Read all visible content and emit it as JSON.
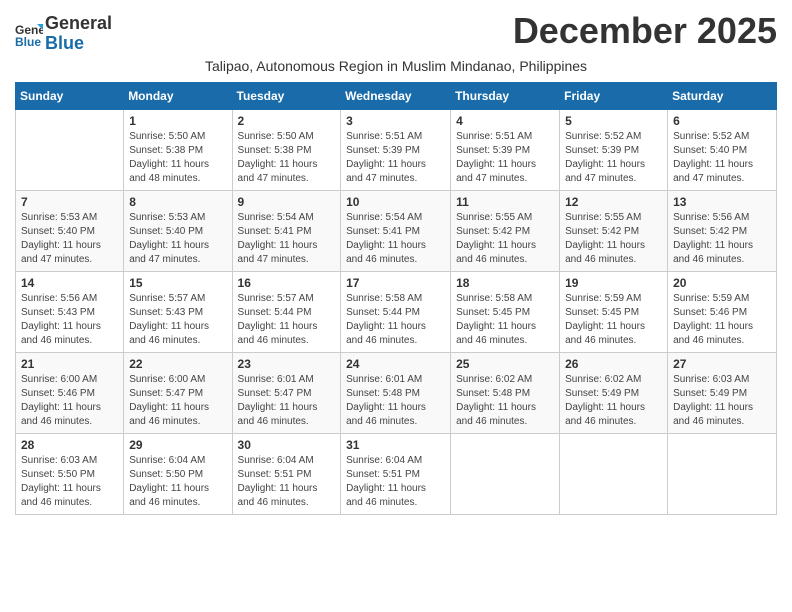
{
  "logo": {
    "line1": "General",
    "line2": "Blue"
  },
  "title": "December 2025",
  "subtitle": "Talipao, Autonomous Region in Muslim Mindanao, Philippines",
  "days_of_week": [
    "Sunday",
    "Monday",
    "Tuesday",
    "Wednesday",
    "Thursday",
    "Friday",
    "Saturday"
  ],
  "weeks": [
    [
      {
        "day": "",
        "info": ""
      },
      {
        "day": "1",
        "info": "Sunrise: 5:50 AM\nSunset: 5:38 PM\nDaylight: 11 hours\nand 48 minutes."
      },
      {
        "day": "2",
        "info": "Sunrise: 5:50 AM\nSunset: 5:38 PM\nDaylight: 11 hours\nand 47 minutes."
      },
      {
        "day": "3",
        "info": "Sunrise: 5:51 AM\nSunset: 5:39 PM\nDaylight: 11 hours\nand 47 minutes."
      },
      {
        "day": "4",
        "info": "Sunrise: 5:51 AM\nSunset: 5:39 PM\nDaylight: 11 hours\nand 47 minutes."
      },
      {
        "day": "5",
        "info": "Sunrise: 5:52 AM\nSunset: 5:39 PM\nDaylight: 11 hours\nand 47 minutes."
      },
      {
        "day": "6",
        "info": "Sunrise: 5:52 AM\nSunset: 5:40 PM\nDaylight: 11 hours\nand 47 minutes."
      }
    ],
    [
      {
        "day": "7",
        "info": "Sunrise: 5:53 AM\nSunset: 5:40 PM\nDaylight: 11 hours\nand 47 minutes."
      },
      {
        "day": "8",
        "info": "Sunrise: 5:53 AM\nSunset: 5:40 PM\nDaylight: 11 hours\nand 47 minutes."
      },
      {
        "day": "9",
        "info": "Sunrise: 5:54 AM\nSunset: 5:41 PM\nDaylight: 11 hours\nand 47 minutes."
      },
      {
        "day": "10",
        "info": "Sunrise: 5:54 AM\nSunset: 5:41 PM\nDaylight: 11 hours\nand 46 minutes."
      },
      {
        "day": "11",
        "info": "Sunrise: 5:55 AM\nSunset: 5:42 PM\nDaylight: 11 hours\nand 46 minutes."
      },
      {
        "day": "12",
        "info": "Sunrise: 5:55 AM\nSunset: 5:42 PM\nDaylight: 11 hours\nand 46 minutes."
      },
      {
        "day": "13",
        "info": "Sunrise: 5:56 AM\nSunset: 5:42 PM\nDaylight: 11 hours\nand 46 minutes."
      }
    ],
    [
      {
        "day": "14",
        "info": "Sunrise: 5:56 AM\nSunset: 5:43 PM\nDaylight: 11 hours\nand 46 minutes."
      },
      {
        "day": "15",
        "info": "Sunrise: 5:57 AM\nSunset: 5:43 PM\nDaylight: 11 hours\nand 46 minutes."
      },
      {
        "day": "16",
        "info": "Sunrise: 5:57 AM\nSunset: 5:44 PM\nDaylight: 11 hours\nand 46 minutes."
      },
      {
        "day": "17",
        "info": "Sunrise: 5:58 AM\nSunset: 5:44 PM\nDaylight: 11 hours\nand 46 minutes."
      },
      {
        "day": "18",
        "info": "Sunrise: 5:58 AM\nSunset: 5:45 PM\nDaylight: 11 hours\nand 46 minutes."
      },
      {
        "day": "19",
        "info": "Sunrise: 5:59 AM\nSunset: 5:45 PM\nDaylight: 11 hours\nand 46 minutes."
      },
      {
        "day": "20",
        "info": "Sunrise: 5:59 AM\nSunset: 5:46 PM\nDaylight: 11 hours\nand 46 minutes."
      }
    ],
    [
      {
        "day": "21",
        "info": "Sunrise: 6:00 AM\nSunset: 5:46 PM\nDaylight: 11 hours\nand 46 minutes."
      },
      {
        "day": "22",
        "info": "Sunrise: 6:00 AM\nSunset: 5:47 PM\nDaylight: 11 hours\nand 46 minutes."
      },
      {
        "day": "23",
        "info": "Sunrise: 6:01 AM\nSunset: 5:47 PM\nDaylight: 11 hours\nand 46 minutes."
      },
      {
        "day": "24",
        "info": "Sunrise: 6:01 AM\nSunset: 5:48 PM\nDaylight: 11 hours\nand 46 minutes."
      },
      {
        "day": "25",
        "info": "Sunrise: 6:02 AM\nSunset: 5:48 PM\nDaylight: 11 hours\nand 46 minutes."
      },
      {
        "day": "26",
        "info": "Sunrise: 6:02 AM\nSunset: 5:49 PM\nDaylight: 11 hours\nand 46 minutes."
      },
      {
        "day": "27",
        "info": "Sunrise: 6:03 AM\nSunset: 5:49 PM\nDaylight: 11 hours\nand 46 minutes."
      }
    ],
    [
      {
        "day": "28",
        "info": "Sunrise: 6:03 AM\nSunset: 5:50 PM\nDaylight: 11 hours\nand 46 minutes."
      },
      {
        "day": "29",
        "info": "Sunrise: 6:04 AM\nSunset: 5:50 PM\nDaylight: 11 hours\nand 46 minutes."
      },
      {
        "day": "30",
        "info": "Sunrise: 6:04 AM\nSunset: 5:51 PM\nDaylight: 11 hours\nand 46 minutes."
      },
      {
        "day": "31",
        "info": "Sunrise: 6:04 AM\nSunset: 5:51 PM\nDaylight: 11 hours\nand 46 minutes."
      },
      {
        "day": "",
        "info": ""
      },
      {
        "day": "",
        "info": ""
      },
      {
        "day": "",
        "info": ""
      }
    ]
  ]
}
